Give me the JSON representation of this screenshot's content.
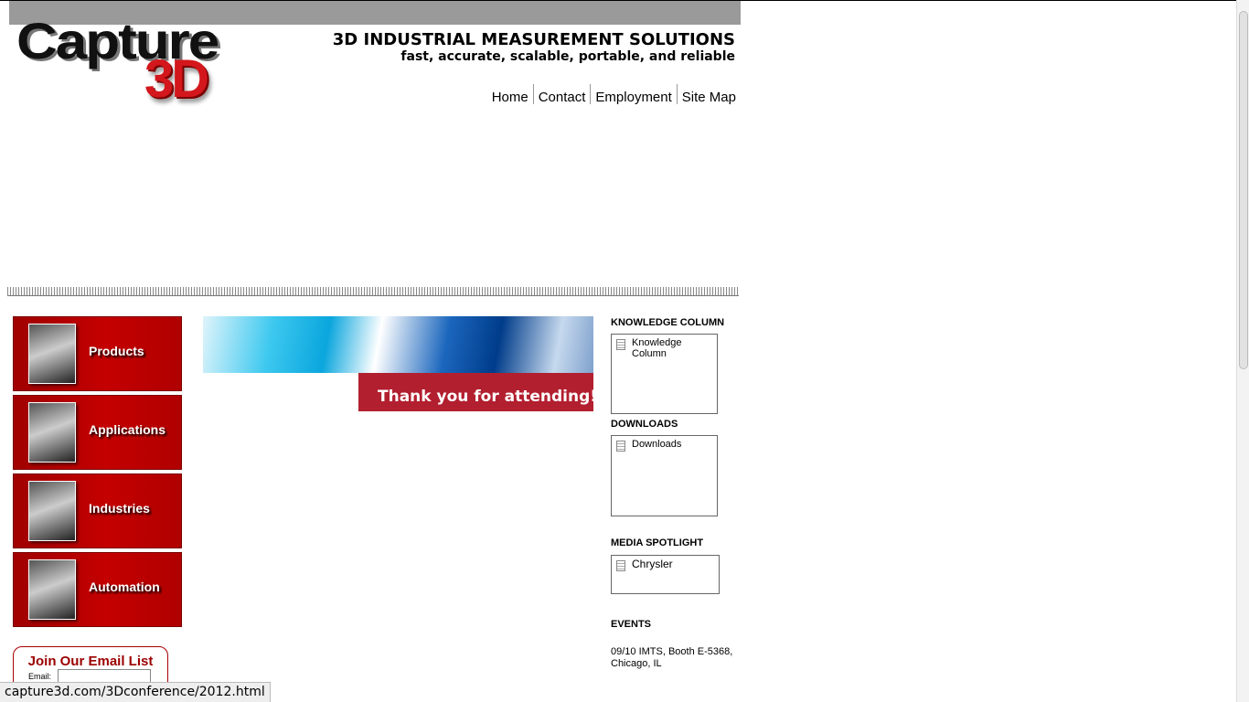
{
  "header": {
    "tagline": "3D INDUSTRIAL MEASUREMENT SOLUTIONS",
    "subtagline": "fast, accurate, scalable, portable, and reliable",
    "logo_word": "Capture",
    "logo_mark": "3D"
  },
  "topnav": [
    "Home",
    "Contact",
    "Employment",
    "Site Map"
  ],
  "leftnav": [
    "Products",
    "Applications",
    "Industries",
    "Automation"
  ],
  "email_signup": {
    "title": "Join Our Email List",
    "label": "Email:",
    "value": ""
  },
  "banner": {
    "text": "Thank you for attending!"
  },
  "sidebar": {
    "knowledge": {
      "heading": "KNOWLEDGE COLUMN",
      "link": "Knowledge Column"
    },
    "downloads": {
      "heading": "DOWNLOADS",
      "link": "Downloads"
    },
    "media": {
      "heading": "MEDIA SPOTLIGHT",
      "link": "Chrysler"
    },
    "events": {
      "heading": "EVENTS",
      "item": "09/10 IMTS, Booth E-5368, Chicago, IL"
    }
  },
  "status_bar": "capture3d.com/3Dconference/2012.html",
  "colors": {
    "nav_red": "#b00000",
    "banner_red": "#b21f2f",
    "heading_red": "#9b0000"
  }
}
